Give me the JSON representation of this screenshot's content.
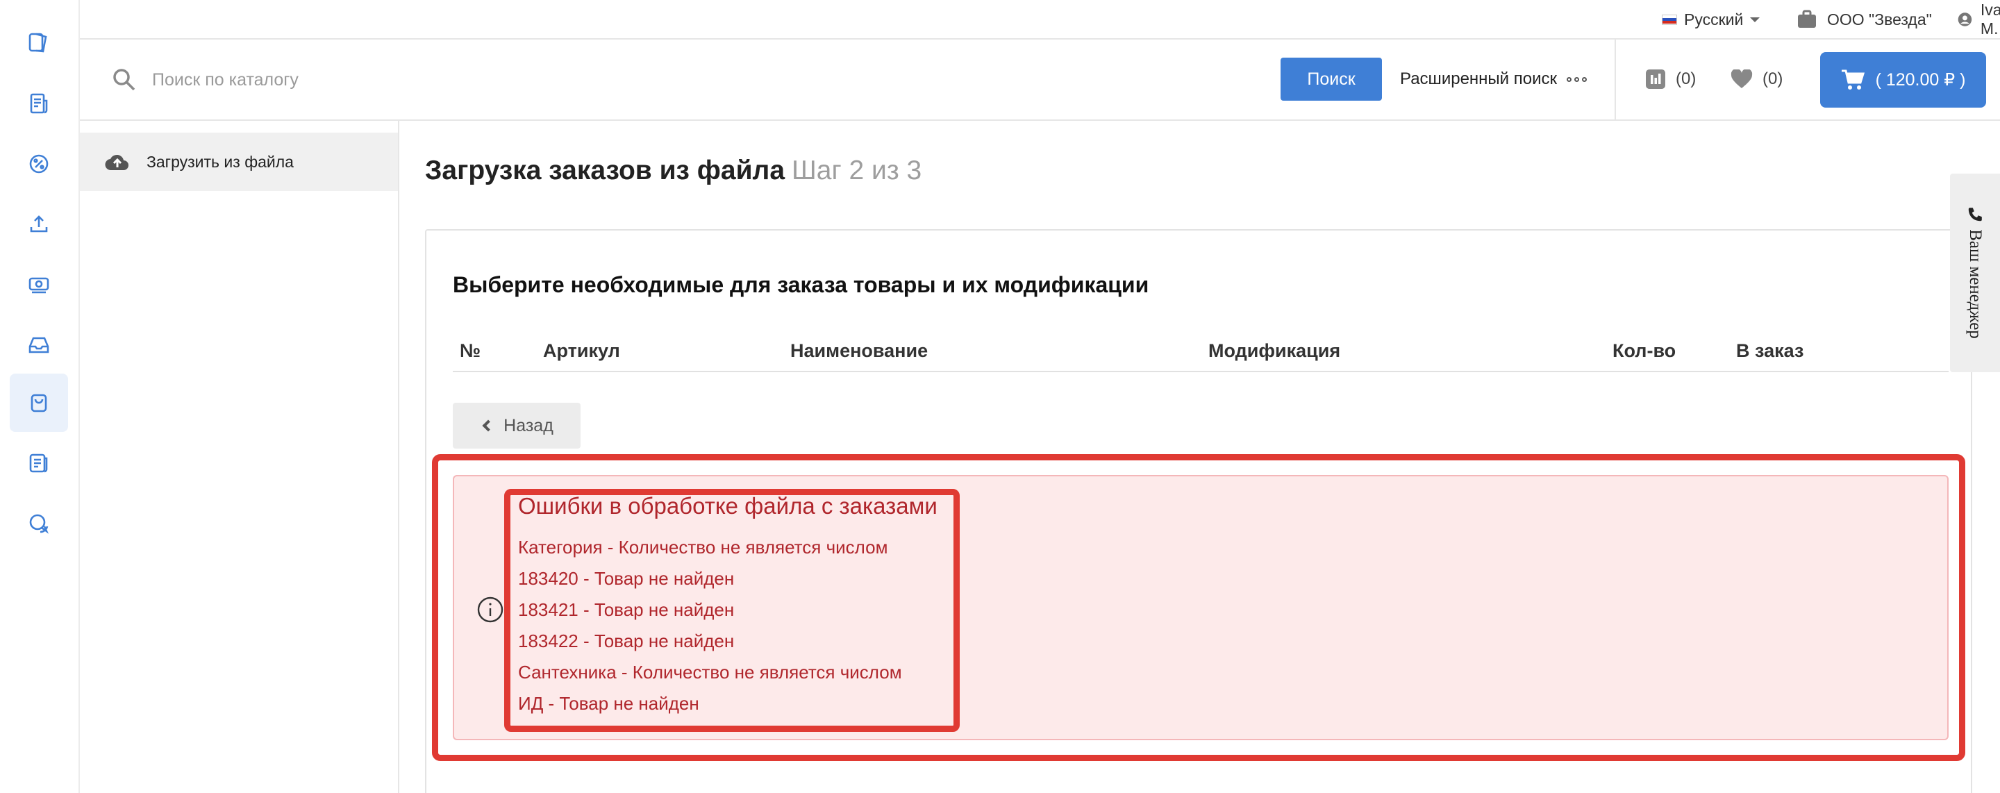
{
  "topbar": {
    "language": "Русский",
    "company": "ООО \"Звезда\"",
    "user": "Ivan M."
  },
  "search": {
    "placeholder": "Поиск по каталогу",
    "button_label": "Поиск",
    "advanced_label": "Расширенный поиск",
    "compare_count": "(0)",
    "favorites_count": "(0)",
    "cart_total": "( 120.00 ₽ )"
  },
  "sidebar": {
    "items": [
      {
        "label": "Загрузить из файла"
      }
    ]
  },
  "rail": {
    "items": [
      {
        "icon": "catalog-icon"
      },
      {
        "icon": "orders-icon"
      },
      {
        "icon": "discount-icon"
      },
      {
        "icon": "upload-icon"
      },
      {
        "icon": "payment-icon"
      },
      {
        "icon": "inbox-icon"
      },
      {
        "icon": "shopping-bag-icon",
        "active": true
      },
      {
        "icon": "documents-icon"
      },
      {
        "icon": "support-chat-icon"
      }
    ]
  },
  "page": {
    "title": "Загрузка заказов из файла",
    "step": "Шаг 2 из 3"
  },
  "panel": {
    "heading": "Выберите необходимые для заказа товары и их модификации",
    "columns": [
      "№",
      "Артикул",
      "Наименование",
      "Модификация",
      "Кол-во",
      "В заказ"
    ],
    "back_label": "Назад"
  },
  "alert": {
    "title": "Ошибки в обработке файла с заказами",
    "lines": [
      "Категория - Количество не является числом",
      "183420 - Товар не найден",
      "183421 - Товар не найден",
      "183422 - Товар не найден",
      "Сантехника - Количество не является числом",
      "ИД - Товар не найден"
    ]
  },
  "manager_tab": {
    "label": "Ваш менеджер"
  },
  "colors": {
    "primary": "#3f7fd6",
    "error_text": "#b0262c",
    "error_bg": "#fdeaea",
    "highlight": "#e03a33"
  }
}
